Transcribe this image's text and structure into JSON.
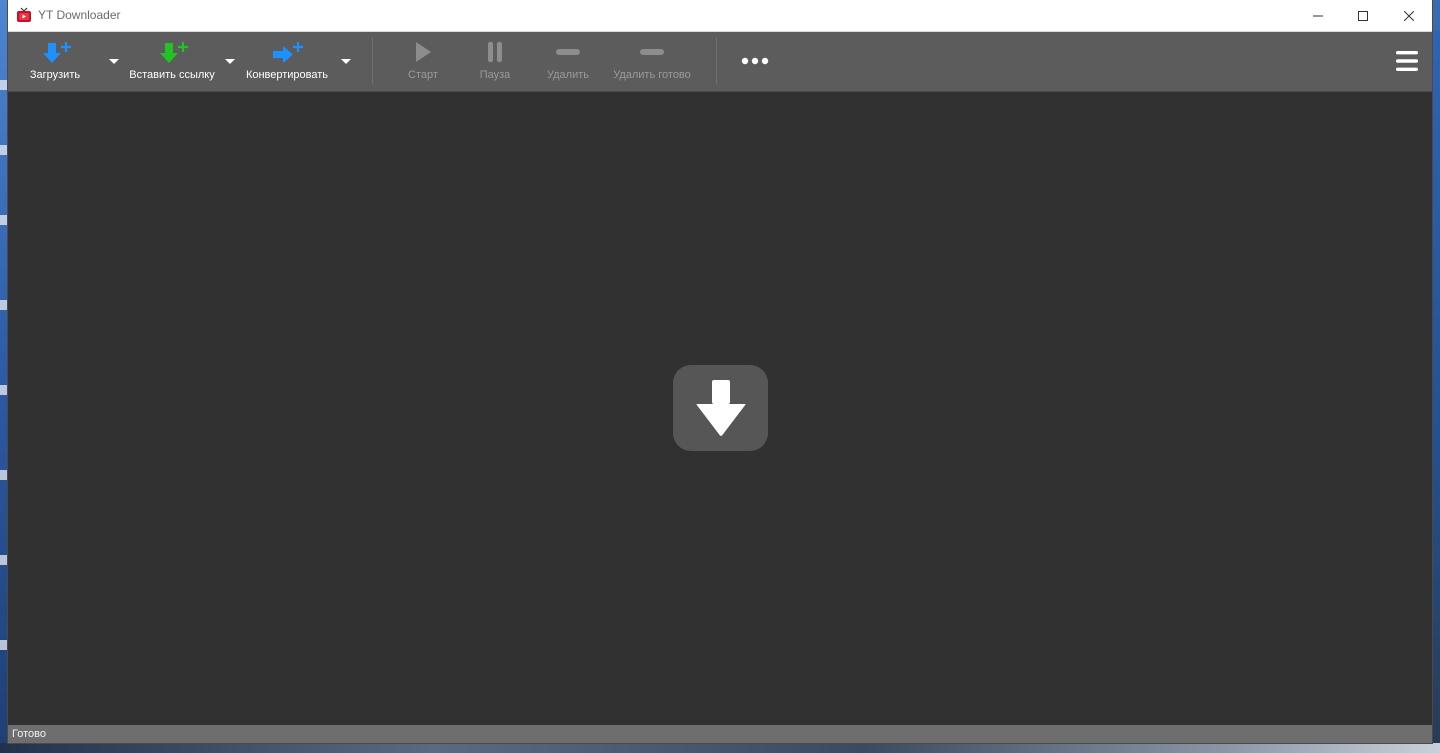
{
  "window": {
    "title": "YT Downloader"
  },
  "toolbar": {
    "download_label": "Загрузить",
    "paste_link_label": "Вставить ссылку",
    "convert_label": "Конвертировать",
    "start_label": "Старт",
    "pause_label": "Пауза",
    "delete_label": "Удалить",
    "delete_done_label": "Удалить готово"
  },
  "status": {
    "text": "Готово"
  },
  "colors": {
    "accent_blue": "#1e90ff",
    "accent_green": "#22c322",
    "toolbar_bg": "#5c5c5c",
    "main_bg": "#313131",
    "drop_tile_bg": "#565656"
  },
  "icons": {
    "download": "arrow-down-plus-icon",
    "paste": "arrow-down-plus-green-icon",
    "convert": "arrow-right-plus-icon",
    "start": "play-icon",
    "pause": "pause-icon",
    "delete": "minus-icon",
    "delete_done": "minus-icon",
    "more": "ellipsis-icon",
    "menu": "hamburger-icon",
    "drop": "download-arrow-icon"
  }
}
